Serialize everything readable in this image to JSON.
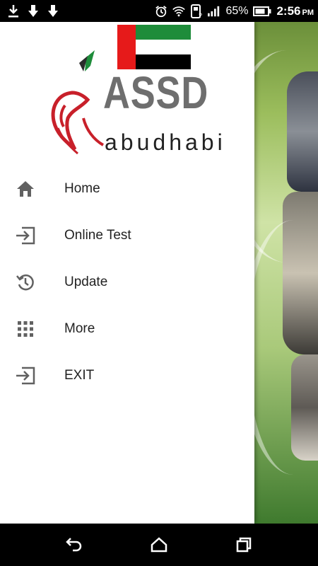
{
  "status_bar": {
    "battery_percent": "65%",
    "time": "2:56",
    "ampm": "PM",
    "left_icons": [
      "download-icon",
      "arrow-down-icon",
      "arrow-down-icon"
    ],
    "right_icons": [
      "alarm-icon",
      "wifi-icon",
      "data-saver-icon",
      "signal-icon",
      "battery-icon"
    ]
  },
  "drawer": {
    "logo": {
      "title": "ASSD",
      "subtitle": "abudhabi"
    },
    "menu": [
      {
        "label": "Home",
        "icon": "home-icon"
      },
      {
        "label": "Online Test",
        "icon": "login-icon"
      },
      {
        "label": "Update",
        "icon": "history-icon"
      },
      {
        "label": "More",
        "icon": "apps-grid-icon"
      },
      {
        "label": "EXIT",
        "icon": "exit-icon"
      }
    ]
  },
  "nav_bar": {
    "buttons": [
      "back-icon",
      "home-icon",
      "recents-icon"
    ]
  },
  "colors": {
    "menu_icon": "#616161",
    "menu_text": "#222222",
    "flag_red": "#e61a1a",
    "flag_green": "#1e8c3a"
  }
}
